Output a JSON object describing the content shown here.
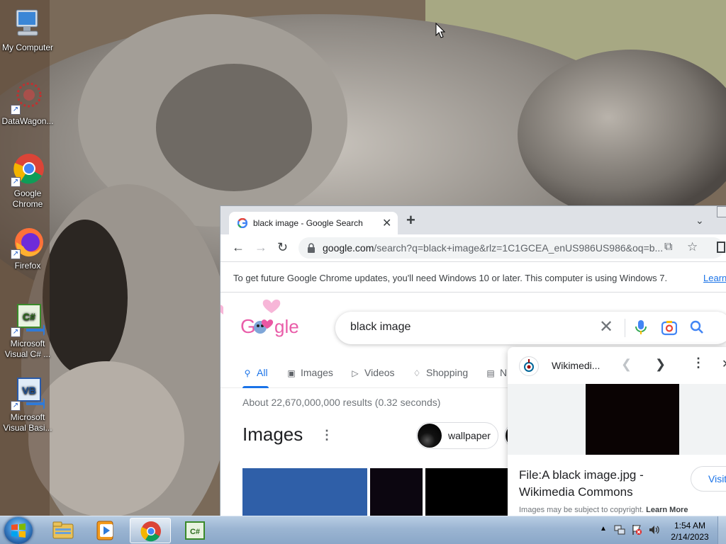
{
  "desktop": {
    "icons": [
      {
        "label": "My Computer",
        "icon": "computer-icon"
      },
      {
        "label": "DataWagon...",
        "icon": "datawagon-icon"
      },
      {
        "label": "Google Chrome",
        "icon": "chrome-icon"
      },
      {
        "label": "Firefox",
        "icon": "firefox-icon"
      },
      {
        "label": "Microsoft Visual C# ...",
        "icon": "visual-csharp-icon"
      },
      {
        "label": "Microsoft Visual Basi...",
        "icon": "visual-basic-icon"
      }
    ],
    "csharp_glyph": "C#",
    "vb_glyph": "VB"
  },
  "browser": {
    "tab_title": "black image - Google Search",
    "tab_close": "✕",
    "new_tab": "+",
    "url_host": "google.com",
    "url_rest": "/search?q=black+image&rlz=1C1GCEA_enUS986US986&oq=b...",
    "infobar_message": "To get future Google Chrome updates, you'll need Windows 10 or later. This computer is using Windows 7.",
    "infobar_link": "Learn"
  },
  "google": {
    "query": "black image",
    "tabs": [
      {
        "label": "All",
        "icon": "search-icon",
        "active": true
      },
      {
        "label": "Images",
        "icon": "image-icon"
      },
      {
        "label": "Videos",
        "icon": "video-icon"
      },
      {
        "label": "Shopping",
        "icon": "tag-icon"
      },
      {
        "label": "N",
        "icon": "news-icon"
      }
    ],
    "result_stats": "About 22,670,000,000 results (0.32 seconds)",
    "images_heading": "Images",
    "chip_label": "wallpaper"
  },
  "knowledge_panel": {
    "source": "Wikimedi...",
    "title": "File:A black image.jpg - Wikimedia Commons",
    "visit_label": "Visit",
    "copyright_text": "Images may be subject to copyright.",
    "learn_more": "Learn More"
  },
  "taskbar": {
    "time": "1:54 AM",
    "date": "2/14/2023",
    "pinned": [
      "explorer-icon",
      "media-player-icon",
      "chrome-icon",
      "visual-csharp-icon"
    ],
    "active_item": "chrome-icon"
  },
  "colors": {
    "google_blue": "#1a73e8",
    "taskbar": "#9bb5d2"
  }
}
